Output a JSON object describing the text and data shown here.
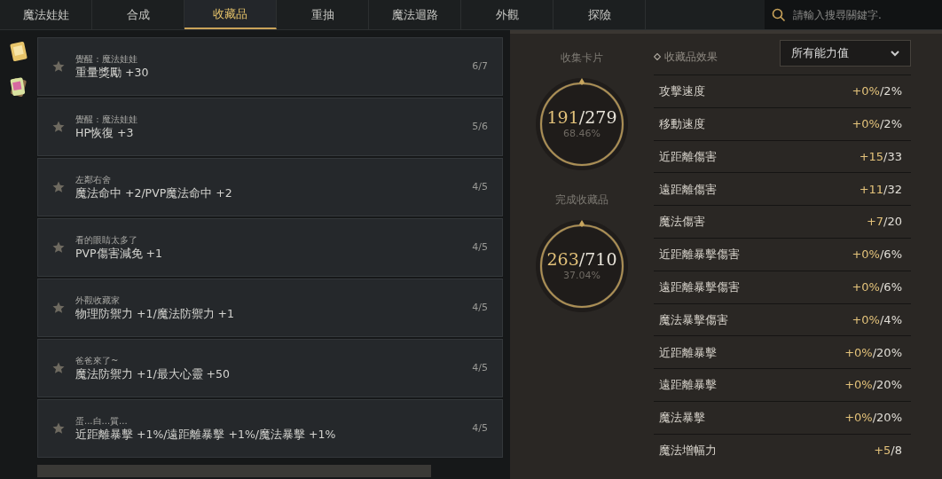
{
  "tabs": [
    {
      "label": "魔法娃娃",
      "selected": false
    },
    {
      "label": "合成",
      "selected": false
    },
    {
      "label": "收藏品",
      "selected": true
    },
    {
      "label": "重抽",
      "selected": false
    },
    {
      "label": "魔法迴路",
      "selected": false
    },
    {
      "label": "外觀",
      "selected": false
    },
    {
      "label": "探險",
      "selected": false
    }
  ],
  "search": {
    "placeholder": "請輸入搜尋關鍵字."
  },
  "collections": [
    {
      "title": "覺醒 : 魔法娃娃",
      "effect": "重量獎勵 +30",
      "progress": "6/7"
    },
    {
      "title": "覺醒 : 魔法娃娃",
      "effect": "HP恢復 +3",
      "progress": "5/6"
    },
    {
      "title": "左鄰右舍",
      "effect": "魔法命中 +2/PVP魔法命中 +2",
      "progress": "4/5"
    },
    {
      "title": "看的眼睛太多了",
      "effect": "PVP傷害減免 +1",
      "progress": "4/5"
    },
    {
      "title": "外觀收藏家",
      "effect": "物理防禦力 +1/魔法防禦力 +1",
      "progress": "4/5"
    },
    {
      "title": "爸爸來了~",
      "effect": "魔法防禦力 +1/最大心靈 +50",
      "progress": "4/5"
    },
    {
      "title": "蛋...白...質...",
      "effect": "近距離暴擊 +1%/遠距離暴擊 +1%/魔法暴擊 +1%",
      "progress": "4/5"
    }
  ],
  "summary": [
    {
      "label": "收集卡片",
      "current": "191",
      "total": "/279",
      "percent": "68.46%"
    },
    {
      "label": "完成收藏品",
      "current": "263",
      "total": "/710",
      "percent": "37.04%"
    }
  ],
  "effects": {
    "title": "收藏品效果",
    "filter": "所有能力值",
    "stats": [
      {
        "name": "攻擊速度",
        "value": "+0%",
        "max": "/2%"
      },
      {
        "name": "移動速度",
        "value": "+0%",
        "max": "/2%"
      },
      {
        "name": "近距離傷害",
        "value": "+15",
        "max": "/33"
      },
      {
        "name": "遠距離傷害",
        "value": "+11",
        "max": "/32"
      },
      {
        "name": "魔法傷害",
        "value": "+7",
        "max": "/20"
      },
      {
        "name": "近距離暴擊傷害",
        "value": "+0%",
        "max": "/6%"
      },
      {
        "name": "遠距離暴擊傷害",
        "value": "+0%",
        "max": "/6%"
      },
      {
        "name": "魔法暴擊傷害",
        "value": "+0%",
        "max": "/4%"
      },
      {
        "name": "近距離暴擊",
        "value": "+0%",
        "max": "/20%"
      },
      {
        "name": "遠距離暴擊",
        "value": "+0%",
        "max": "/20%"
      },
      {
        "name": "魔法暴擊",
        "value": "+0%",
        "max": "/20%"
      },
      {
        "name": "魔法增幅力",
        "value": "+5",
        "max": "/8"
      }
    ]
  }
}
